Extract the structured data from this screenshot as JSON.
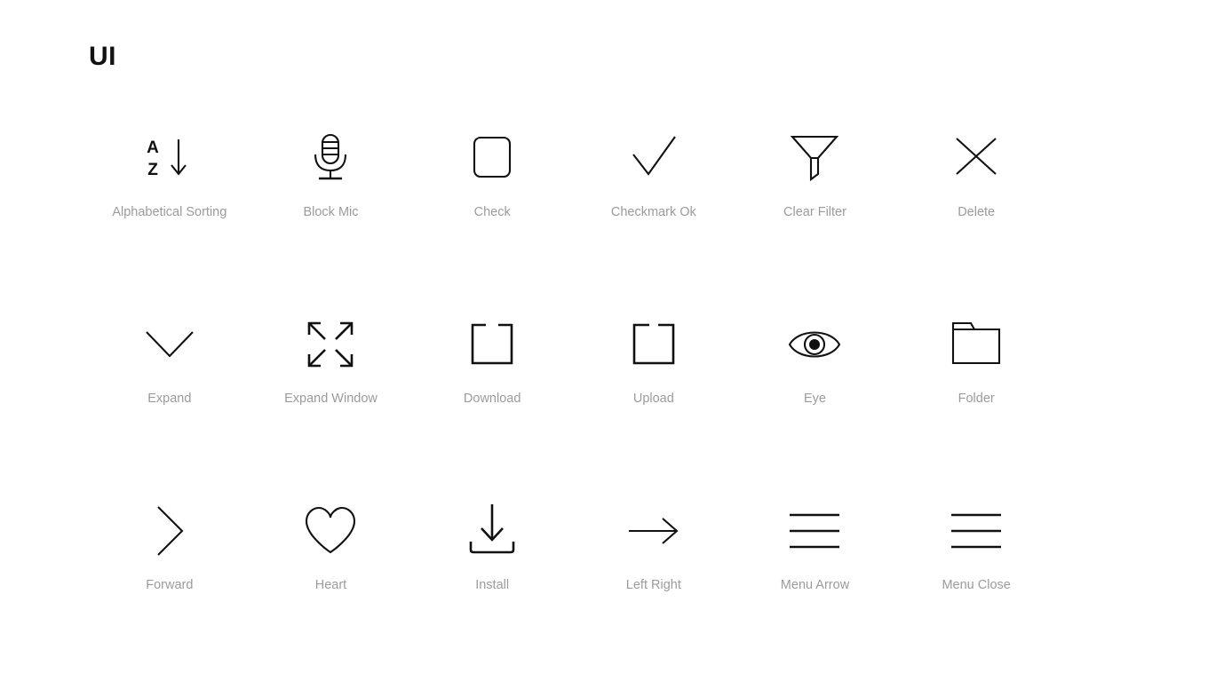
{
  "page": {
    "title": "UI",
    "background_color": "#ffffff",
    "label_color": "#9b9b9b",
    "icon_color": "#111111"
  },
  "grid": {
    "columns": 6,
    "rows": 3
  },
  "icons": [
    {
      "id": "alphabetical-sorting",
      "label": "Alphabetical Sorting",
      "glyph": "letters-a-z-arrow-down-icon"
    },
    {
      "id": "block-mic",
      "label": "Block Mic",
      "glyph": "microphone-icon"
    },
    {
      "id": "check",
      "label": "Check",
      "glyph": "rounded-square-checkbox-icon"
    },
    {
      "id": "checkmark-ok",
      "label": "Checkmark Ok",
      "glyph": "checkmark-icon"
    },
    {
      "id": "clear-filter",
      "label": "Clear Filter",
      "glyph": "funnel-icon"
    },
    {
      "id": "delete",
      "label": "Delete",
      "glyph": "close-x-icon"
    },
    {
      "id": "expand",
      "label": "Expand",
      "glyph": "chevron-down-icon"
    },
    {
      "id": "expand-window",
      "label": "Expand Window",
      "glyph": "four-arrows-outward-icon"
    },
    {
      "id": "download",
      "label": "Download",
      "glyph": "tray-open-top-icon"
    },
    {
      "id": "upload",
      "label": "Upload",
      "glyph": "tray-open-top-icon"
    },
    {
      "id": "eye",
      "label": "Eye",
      "glyph": "eye-icon"
    },
    {
      "id": "folder",
      "label": "Folder",
      "glyph": "folder-icon"
    },
    {
      "id": "forward",
      "label": "Forward",
      "glyph": "chevron-right-icon"
    },
    {
      "id": "heart",
      "label": "Heart",
      "glyph": "heart-outline-icon"
    },
    {
      "id": "install",
      "label": "Install",
      "glyph": "arrow-down-to-tray-icon"
    },
    {
      "id": "left-right",
      "label": "Left Right",
      "glyph": "arrow-right-icon"
    },
    {
      "id": "menu-arrow",
      "label": "Menu Arrow",
      "glyph": "hamburger-menu-icon"
    },
    {
      "id": "menu-close",
      "label": "Menu Close",
      "glyph": "hamburger-menu-icon"
    }
  ]
}
